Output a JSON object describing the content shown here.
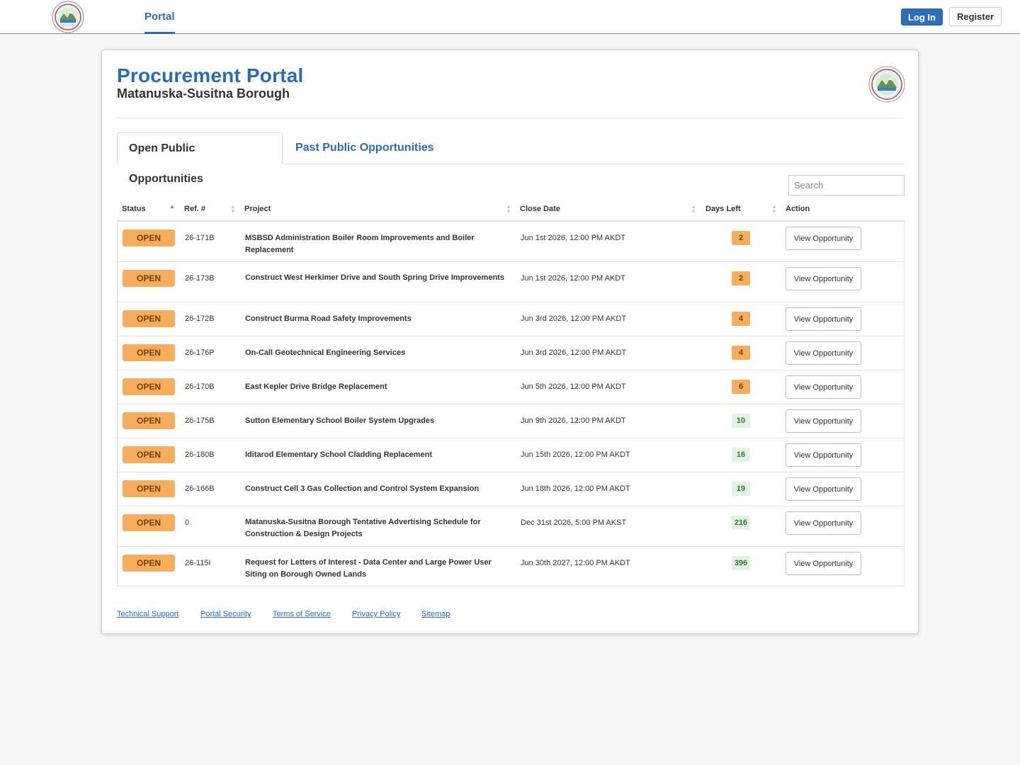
{
  "topnav": {
    "nav_portal": "Portal",
    "login_label": "Log In",
    "register_label": "Register"
  },
  "header": {
    "title": "Procurement Portal",
    "subtitle": "Matanuska-Susitna Borough"
  },
  "tabs": [
    {
      "label": "Open Public Opportunities",
      "active": true
    },
    {
      "label": "Past Public Opportunities",
      "active": false
    }
  ],
  "search": {
    "placeholder": "Search"
  },
  "table": {
    "columns": [
      "Status",
      "Ref. #",
      "Project",
      "Close Date",
      "Days Left",
      "Action"
    ],
    "rows": [
      {
        "status": "OPEN",
        "ref": "26-171B",
        "project": "MSBSD Administration Boiler Room Improvements and Boiler Replacement",
        "close": "Jun 1st 2026, 12:00 PM AKDT",
        "days": "2",
        "action": "View Opportunity"
      },
      {
        "status": "OPEN",
        "ref": "26-173B",
        "project": "Construct West Herkimer Drive and South Spring Drive Improvements",
        "close": "Jun 1st 2026, 12:00 PM AKDT",
        "days": "2",
        "action": "View Opportunity"
      },
      {
        "status": "OPEN",
        "ref": "26-172B",
        "project": "Construct Burma Road Safety Improvements",
        "close": "Jun 3rd 2026, 12:00 PM AKDT",
        "days": "4",
        "action": "View Opportunity"
      },
      {
        "status": "OPEN",
        "ref": "26-176P",
        "project": "On-Call Geotechnical Engineering Services",
        "close": "Jun 3rd 2026, 12:00 PM AKDT",
        "days": "4",
        "action": "View Opportunity"
      },
      {
        "status": "OPEN",
        "ref": "26-170B",
        "project": "East Kepler Drive Bridge Replacement",
        "close": "Jun 5th 2026, 12:00 PM AKDT",
        "days": "6",
        "action": "View Opportunity"
      },
      {
        "status": "OPEN",
        "ref": "26-175B",
        "project": "Sutton Elementary School Boiler System Upgrades",
        "close": "Jun 9th 2026, 12:00 PM AKDT",
        "days": "10",
        "action": "View Opportunity"
      },
      {
        "status": "OPEN",
        "ref": "26-180B",
        "project": "Iditarod Elementary School Cladding Replacement",
        "close": "Jun 15th 2026, 12:00 PM AKDT",
        "days": "16",
        "action": "View Opportunity"
      },
      {
        "status": "OPEN",
        "ref": "26-166B",
        "project": "Construct Cell 3 Gas Collection and Control System Expansion",
        "close": "Jun 18th 2026, 12:00 PM AKDT",
        "days": "19",
        "action": "View Opportunity"
      },
      {
        "status": "OPEN",
        "ref": "0",
        "project": "Matanuska-Susitna Borough Tentative Advertising Schedule for Construction & Design Projects",
        "close": "Dec 31st 2026, 5:00 PM AKST",
        "days": "216",
        "action": "View Opportunity"
      },
      {
        "status": "OPEN",
        "ref": "26-115I",
        "project": "Request for Letters of Interest - Data Center and Large Power User Siting on Borough Owned Lands",
        "close": "Jun 30th 2027, 12:00 PM AKDT",
        "days": "396",
        "action": "View Opportunity"
      }
    ]
  },
  "footer": {
    "links": [
      "Technical Support",
      "Portal Security",
      "Terms of Service",
      "Privacy Policy",
      "Sitemap"
    ]
  },
  "colors": {
    "brand_blue": "#2b6cb0",
    "open_badge": "#f6ad5e",
    "days_warning": "#f6ad5e",
    "days_ok": "#e3f3e3"
  }
}
